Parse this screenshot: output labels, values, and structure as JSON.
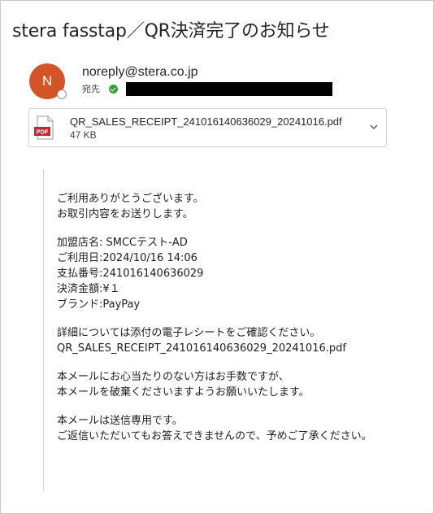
{
  "email": {
    "subject": "stera fasstap／QR決済完了のお知らせ",
    "sender": {
      "avatar_initial": "N",
      "address": "noreply@stera.co.jp",
      "to_label": "宛先"
    },
    "attachment": {
      "icon": "pdf-file-icon",
      "icon_text": "PDF",
      "filename": "QR_SALES_RECEIPT_241016140636029_20241016.pdf",
      "size": "47 KB"
    },
    "body": {
      "paragraphs": [
        [
          "ご利用ありがとうございます。",
          "お取引内容をお送りします。"
        ],
        [
          "加盟店名: SMCCテスト-AD",
          "ご利用日:2024/10/16 14:06",
          "支払番号:241016140636029",
          "決済金額:¥１",
          "ブランド:PayPay"
        ],
        [
          "詳細については添付の電子レシートをご確認ください。",
          "QR_SALES_RECEIPT_241016140636029_20241016.pdf"
        ],
        [
          "本メールにお心当たりのない方はお手数ですが、",
          "本メールを破棄くださいますようお願いいたします。"
        ],
        [
          "本メールは送信専用です。",
          "ご返信いただいてもお答えできませんので、予めご了承ください。"
        ]
      ]
    }
  },
  "colors": {
    "avatar": "#d35427",
    "verified": "#37a037",
    "pdf_red": "#c4262e"
  }
}
